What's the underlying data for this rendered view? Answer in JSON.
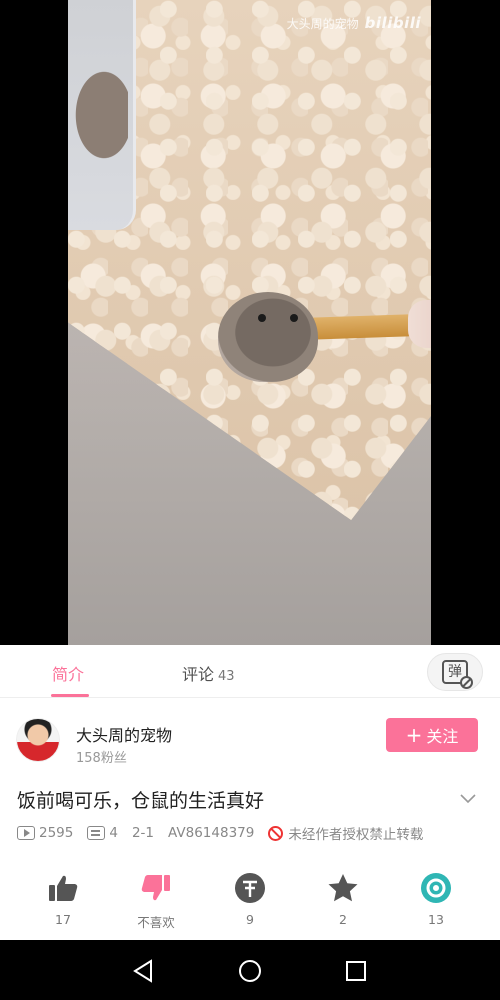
{
  "video": {
    "watermark_channel": "大头周的宠物",
    "watermark_logo": "bilibili"
  },
  "tabs": {
    "intro_label": "简介",
    "comments_label": "评论",
    "comments_count": "43"
  },
  "uploader": {
    "name": "大头周的宠物",
    "fans": "158粉丝",
    "follow_label": "关注"
  },
  "video_info": {
    "title": "饭前喝可乐，仓鼠的生活真好",
    "plays": "2595",
    "danmaku": "4",
    "date": "2-1",
    "av_id": "AV86148379",
    "copyright_notice": "未经作者授权禁止转载"
  },
  "actions": {
    "like_count": "17",
    "dislike_label": "不喜欢",
    "coin_count": "9",
    "favorite_count": "2",
    "share_count": "13"
  },
  "colors": {
    "accent": "#fb7299",
    "coin": "#555555",
    "share": "#2fb6b4"
  },
  "icons": [
    "thumbs-up-icon",
    "thumbs-down-icon",
    "coin-icon",
    "star-icon",
    "share-icon",
    "danmaku-off-icon",
    "chevron-down-icon",
    "back-icon",
    "home-icon",
    "recent-apps-icon"
  ]
}
